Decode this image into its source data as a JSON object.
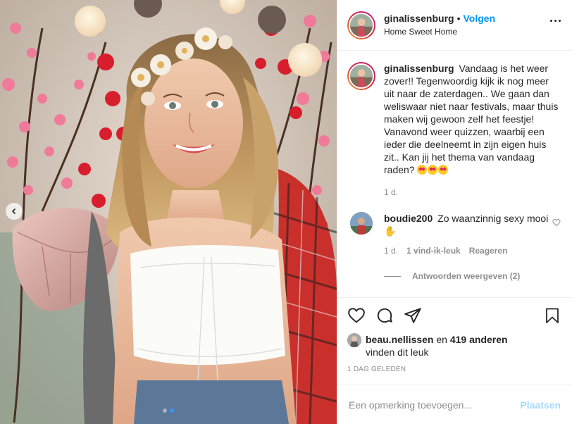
{
  "header": {
    "username": "ginalissenburg",
    "separator": "•",
    "follow_label": "Volgen",
    "location": "Home Sweet Home"
  },
  "caption": {
    "username": "ginalissenburg",
    "text": "Vandaag is het weer zover!! Tegenwoordig kijk ik nog meer uit naar de zaterdagen.. We gaan dan weliswaar niet naar festivals, maar thuis maken wij gewoon zelf het feestje! Vanavond weer quizzen, waarbij een ieder die deelneemt in zijn eigen huis zit.. Kan jij het thema van vandaag raden?",
    "emojis": [
      "heart-eyes-emoji",
      "heart-eyes-emoji",
      "heart-eyes-emoji"
    ],
    "time": "1 d."
  },
  "comments": [
    {
      "username": "boudie200",
      "text": "Zo waanzinnig sexy mooi",
      "emoji": "ok-hand-emoji",
      "time": "1 d.",
      "likes": "1 vind-ik-leuk",
      "reply_label": "Reageren",
      "view_replies": "Antwoorden weergeven (2)"
    }
  ],
  "likes": {
    "liker": "beau.nellissen",
    "connector": "en",
    "others": "419 anderen",
    "suffix": "vinden dit leuk"
  },
  "post_date": "1 DAG GELEDEN",
  "add_comment": {
    "placeholder": "Een opmerking toevoegen...",
    "post_label": "Plaatsen"
  },
  "carousel": {
    "count": 2,
    "active": 2
  },
  "colors": {
    "follow": "#0095f6",
    "story_ring_start": "#f09433",
    "story_ring_end": "#bc1888",
    "muted": "#8e8e8e",
    "text": "#262626"
  },
  "icons": [
    "more-options-icon",
    "heart-icon",
    "comment-icon",
    "share-icon",
    "bookmark-icon",
    "carousel-prev-icon"
  ]
}
